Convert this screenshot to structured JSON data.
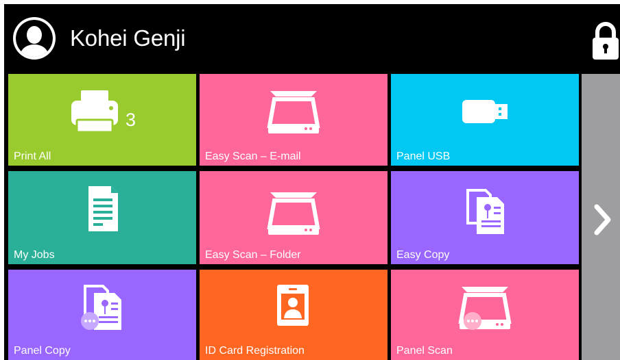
{
  "header": {
    "user_name": "Kohei Genji",
    "avatar_icon": "user-avatar-icon",
    "lock_icon": "lock-icon"
  },
  "tiles": [
    {
      "label": "Print All",
      "color": "#9acb2e",
      "icon": "printer-icon",
      "badge": "3"
    },
    {
      "label": "Easy Scan – E-mail",
      "color": "#ff6699",
      "icon": "scanner-icon"
    },
    {
      "label": "Panel USB",
      "color": "#00c8f2",
      "icon": "usb-drive-icon"
    },
    {
      "label": "My Jobs",
      "color": "#2ab098",
      "icon": "document-icon"
    },
    {
      "label": "Easy Scan – Folder",
      "color": "#ff6699",
      "icon": "scanner-icon"
    },
    {
      "label": "Easy Copy",
      "color": "#9966ff",
      "icon": "copy-documents-icon"
    },
    {
      "label": "Panel Copy",
      "color": "#9966ff",
      "icon": "copy-documents-icon"
    },
    {
      "label": "ID Card Registration",
      "color": "#ff6622",
      "icon": "id-card-icon"
    },
    {
      "label": "Panel Scan",
      "color": "#ff6699",
      "icon": "scanner-icon"
    }
  ],
  "navigation": {
    "next_icon": "chevron-right-icon",
    "next_color": "#9e9ea1"
  }
}
